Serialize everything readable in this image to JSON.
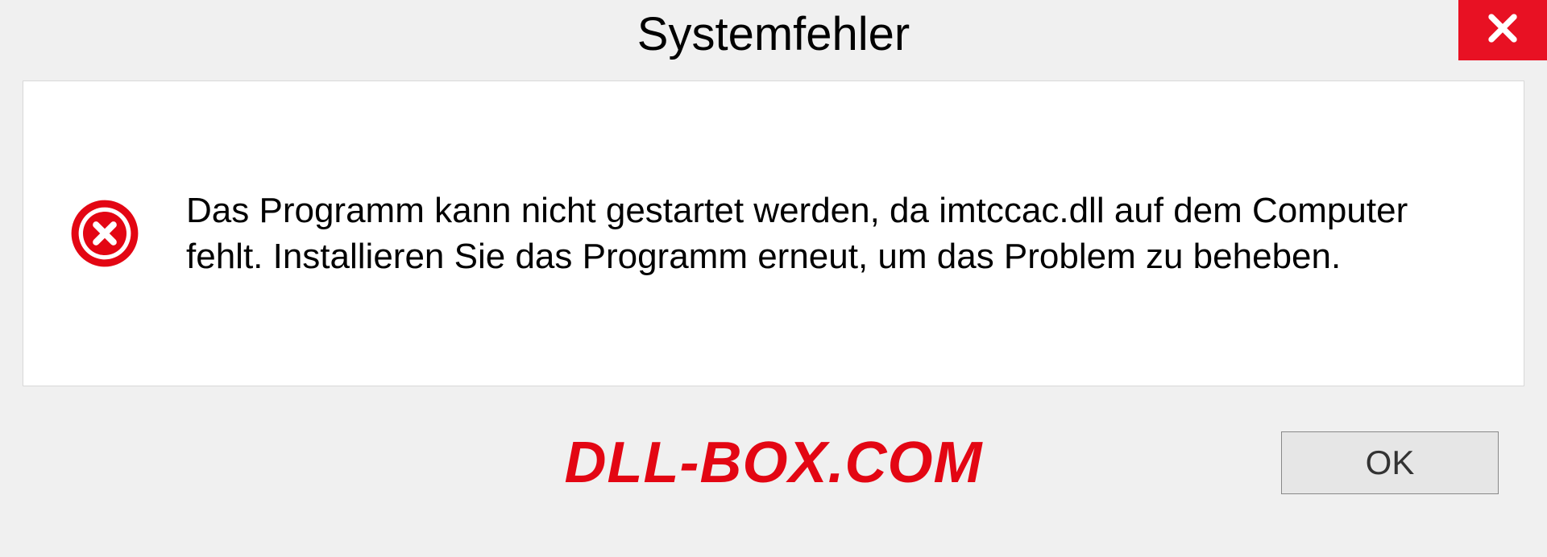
{
  "dialog": {
    "title": "Systemfehler",
    "message": "Das Programm kann nicht gestartet werden, da imtccac.dll auf dem Computer fehlt. Installieren Sie das Programm erneut, um das Problem zu beheben.",
    "ok_label": "OK"
  },
  "watermark": "DLL-BOX.COM",
  "colors": {
    "close_bg": "#e81123",
    "error_icon": "#e30613",
    "watermark": "#e30613"
  }
}
